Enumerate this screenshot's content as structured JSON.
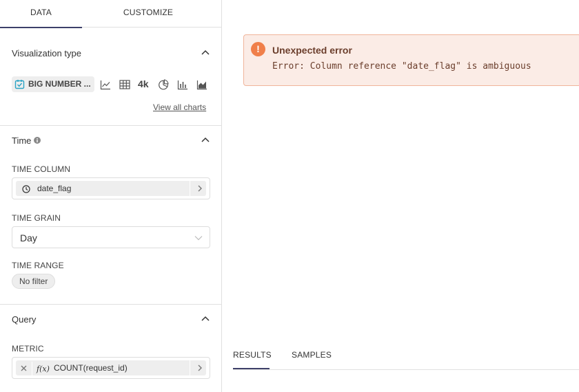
{
  "tabs": {
    "data": "DATA",
    "customize": "CUSTOMIZE"
  },
  "viz": {
    "section_title": "Visualization type",
    "selected": "BIG NUMBER ...",
    "icons": [
      "line-chart-icon",
      "table-icon",
      "big-number-icon",
      "pie-chart-icon",
      "bar-chart-icon",
      "area-chart-icon"
    ],
    "big_number_glyph": "4k",
    "view_all": "View all charts"
  },
  "time": {
    "section_title": "Time",
    "column_label": "TIME COLUMN",
    "column_value": "date_flag",
    "grain_label": "TIME GRAIN",
    "grain_value": "Day",
    "range_label": "TIME RANGE",
    "range_value": "No filter"
  },
  "query": {
    "section_title": "Query",
    "metric_label": "METRIC",
    "metric_fx": "f(x)",
    "metric_value": "COUNT(request_id)"
  },
  "error": {
    "title": "Unexpected error",
    "message": "Error: Column reference \"date_flag\" is ambiguous",
    "color": "#f07f4a"
  },
  "results_tabs": {
    "results": "RESULTS",
    "samples": "SAMPLES"
  },
  "colors": {
    "accent": "#3d3f69",
    "chip_bg": "#eeeeee",
    "error_bg": "#fbece6"
  }
}
